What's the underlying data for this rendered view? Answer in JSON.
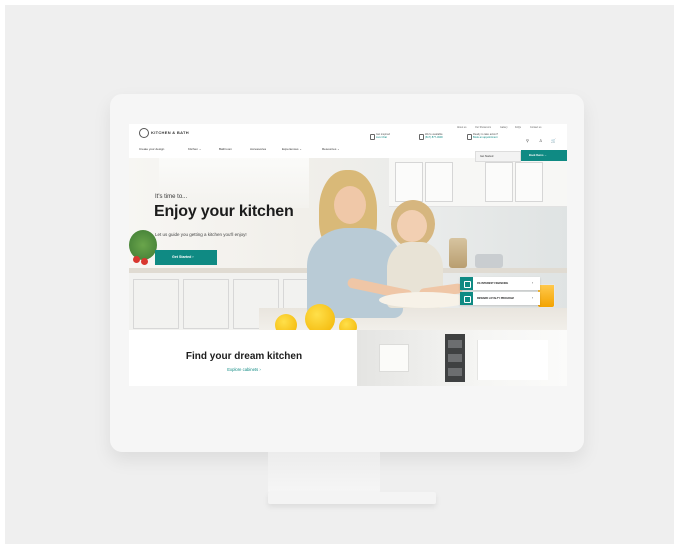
{
  "site": {
    "brand": "KITCHEN & BATH",
    "utility_links": [
      "About us",
      "Our Showroom",
      "Gallery",
      "FAQs",
      "Contact us"
    ],
    "header_info": [
      {
        "title": "Get inspired",
        "sub": "Live Chat"
      },
      {
        "title": "We're available",
        "sub": "(617) 877-4900"
      },
      {
        "title": "Ready to take action?",
        "sub": "Book an appointment"
      }
    ],
    "icons": [
      "search-icon",
      "user-icon",
      "cart-icon"
    ],
    "nav": [
      "Create your design",
      "Kitchen ⌄",
      "Bathroom",
      "Accessories",
      "Experiences ⌄",
      "Resources ⌄"
    ],
    "store_select": "Get Started",
    "book_button": "Book Demo  →"
  },
  "hero": {
    "pretitle": "It's time to...",
    "title": "Enjoy your kitchen",
    "subtitle": "Let us guide you getting a kitchen you'll enjoy!",
    "cta": "Get Started  ›",
    "promos": [
      {
        "label": "0% INTEREST FINANCING",
        "chevron": "›"
      },
      {
        "label": "REWARD LOYALTY PROGRAM",
        "chevron": "›"
      }
    ]
  },
  "section": {
    "title": "Find your dream kitchen",
    "link": "Explore cabinets  ›"
  },
  "colors": {
    "accent": "#0f8a83",
    "background": "#efefef"
  }
}
